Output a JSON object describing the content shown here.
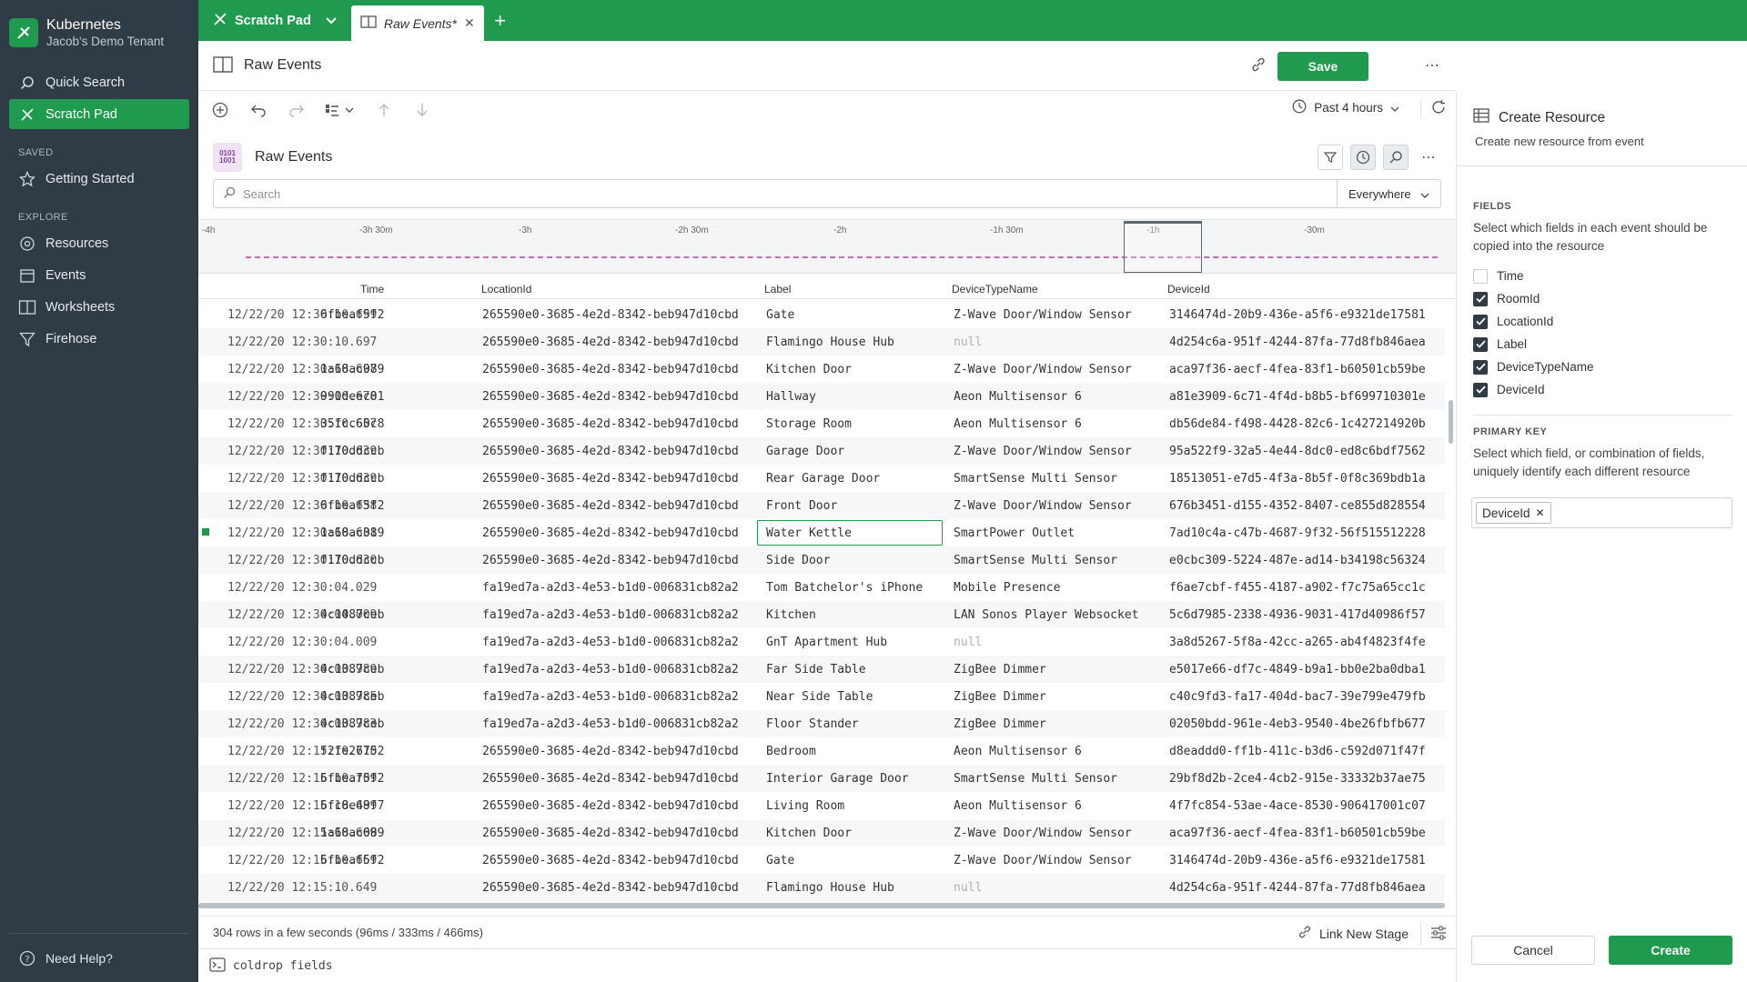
{
  "colors": {
    "brand_green": "#1f9a4f",
    "sidebar_bg": "#2f3b45",
    "selected_outline": "#1f9a4f",
    "timeline_line": "#b04fa0"
  },
  "sidebar": {
    "app_title": "Kubernetes",
    "tenant": "Jacob's Demo Tenant",
    "nav": [
      {
        "label": "Quick Search",
        "icon": "search-icon"
      },
      {
        "label": "Scratch Pad",
        "icon": "scratch-pad-icon",
        "active": true
      }
    ],
    "saved_label": "SAVED",
    "saved": [
      {
        "label": "Getting Started",
        "icon": "star-icon"
      }
    ],
    "explore_label": "EXPLORE",
    "explore": [
      {
        "label": "Resources",
        "icon": "resources-icon"
      },
      {
        "label": "Events",
        "icon": "calendar-icon"
      },
      {
        "label": "Worksheets",
        "icon": "worksheet-icon"
      },
      {
        "label": "Firehose",
        "icon": "funnel-icon"
      }
    ],
    "help_label": "Need Help?"
  },
  "topbar": {
    "scratch_tab": "Scratch Pad",
    "worksheet_tab": "Raw Events*"
  },
  "header": {
    "title": "Raw Events",
    "save_label": "Save"
  },
  "toolbar": {
    "time_range": "Past 4 hours"
  },
  "stage": {
    "icon_text": "0101 1001",
    "title": "Raw Events",
    "search_placeholder": "Search",
    "scope": "Everywhere"
  },
  "timeline": {
    "labels": [
      "-4h",
      "-3h 30m",
      "-3h",
      "-2h 30m",
      "-2h",
      "-1h 30m",
      "-1h",
      "-30m"
    ]
  },
  "table": {
    "columns": [
      "Time",
      "LocationId",
      "Label",
      "DeviceTypeName",
      "DeviceId"
    ],
    "rows": [
      {
        "time": "12/22/20 12:30:10.699",
        "room": "6fbeaf5f2",
        "location": "265590e0-3685-4e2d-8342-beb947d10cbd",
        "label": "Gate",
        "type": "Z-Wave Door/Window Sensor",
        "device": "3146474d-20b9-436e-a5f6-e9321de17581"
      },
      {
        "time": "12/22/20 12:30:10.697",
        "room": "",
        "location": "265590e0-3685-4e2d-8342-beb947d10cbd",
        "label": "Flamingo House Hub",
        "type": "null",
        "device": "4d254c6a-951f-4244-87fa-77d8fb846aea"
      },
      {
        "time": "12/22/20 12:30:10.697",
        "room": "1a68ac089",
        "location": "265590e0-3685-4e2d-8342-beb947d10cbd",
        "label": "Kitchen Door",
        "type": "Z-Wave Door/Window Sensor",
        "device": "aca97f36-aecf-4fea-83f1-b60501cb59be"
      },
      {
        "time": "12/22/20 12:30:10.678",
        "room": "990deec01",
        "location": "265590e0-3685-4e2d-8342-beb947d10cbd",
        "label": "Hallway",
        "type": "Aeon Multisensor 6",
        "device": "a81e3909-6c71-4f4d-b8b5-bf699710301e"
      },
      {
        "time": "12/22/20 12:30:10.657",
        "room": "35fcc60c8",
        "location": "265590e0-3685-4e2d-8342-beb947d10cbd",
        "label": "Storage Room",
        "type": "Aeon Multisensor 6",
        "device": "db56de84-f498-4428-82c6-1c427214920b"
      },
      {
        "time": "12/22/20 12:30:10.639",
        "room": "f170ddccb",
        "location": "265590e0-3685-4e2d-8342-beb947d10cbd",
        "label": "Garage Door",
        "type": "Z-Wave Door/Window Sensor",
        "device": "95a522f9-32a5-4e44-8dc0-ed8c6bdf7562"
      },
      {
        "time": "12/22/20 12:30:10.639",
        "room": "f170ddccb",
        "location": "265590e0-3685-4e2d-8342-beb947d10cbd",
        "label": "Rear Garage Door",
        "type": "SmartSense Multi Sensor",
        "device": "18513051-e7d5-4f3a-8b5f-0f8c369bdb1a"
      },
      {
        "time": "12/22/20 12:30:10.638",
        "room": "6fbeaf5f2",
        "location": "265590e0-3685-4e2d-8342-beb947d10cbd",
        "label": "Front Door",
        "type": "Z-Wave Door/Window Sensor",
        "device": "676b3451-d155-4352-8407-ce855d828554"
      },
      {
        "time": "12/22/20 12:30:10.631",
        "room": "1a68ac089",
        "location": "265590e0-3685-4e2d-8342-beb947d10cbd",
        "label": "Water Kettle",
        "type": "SmartPower Outlet",
        "device": "7ad10c4a-c47b-4687-9f32-56f515512228",
        "selected": true
      },
      {
        "time": "12/22/20 12:30:10.630",
        "room": "f170ddccb",
        "location": "265590e0-3685-4e2d-8342-beb947d10cbd",
        "label": "Side Door",
        "type": "SmartSense Multi Sensor",
        "device": "e0cbc309-5224-487e-ad14-b34198c56324"
      },
      {
        "time": "12/22/20 12:30:04.029",
        "room": "",
        "location": "fa19ed7a-a2d3-4e53-b1d0-006831cb82a2",
        "label": "Tom Batchelor's iPhone",
        "type": "Mobile Presence",
        "device": "f6ae7cbf-f455-4187-a902-f7c75a65cc1c"
      },
      {
        "time": "12/22/20 12:30:04.009",
        "room": "4c1087ceb",
        "location": "fa19ed7a-a2d3-4e53-b1d0-006831cb82a2",
        "label": "Kitchen",
        "type": "LAN Sonos Player Websocket",
        "device": "5c6d7985-2338-4936-9031-417d40986f57"
      },
      {
        "time": "12/22/20 12:30:04.009",
        "room": "",
        "location": "fa19ed7a-a2d3-4e53-b1d0-006831cb82a2",
        "label": "GnT Apartment Hub",
        "type": "null",
        "device": "3a8d5267-5f8a-42cc-a265-ab4f4823f4fe"
      },
      {
        "time": "12/22/20 12:30:03.989",
        "room": "4c1087ceb",
        "location": "fa19ed7a-a2d3-4e53-b1d0-006831cb82a2",
        "label": "Far Side Table",
        "type": "ZigBee Dimmer",
        "device": "e5017e66-df7c-4849-b9a1-bb0e2ba0dba1"
      },
      {
        "time": "12/22/20 12:30:03.985",
        "room": "4c1087ceb",
        "location": "fa19ed7a-a2d3-4e53-b1d0-006831cb82a2",
        "label": "Near Side Table",
        "type": "ZigBee Dimmer",
        "device": "c40c9fd3-fa17-404d-bac7-39e799e479fb"
      },
      {
        "time": "12/22/20 12:30:03.983",
        "room": "4c1087ceb",
        "location": "fa19ed7a-a2d3-4e53-b1d0-006831cb82a2",
        "label": "Floor Stander",
        "type": "ZigBee Dimmer",
        "device": "02050bdd-961e-4eb3-9540-4be26fbfb677"
      },
      {
        "time": "12/22/20 12:15:10.710",
        "room": "f2fe26752",
        "location": "265590e0-3685-4e2d-8342-beb947d10cbd",
        "label": "Bedroom",
        "type": "Aeon Multisensor 6",
        "device": "d8eaddd0-ff1b-411c-b3d6-c592d071f47f"
      },
      {
        "time": "12/22/20 12:15:10.709",
        "room": "6fbeaf5f2",
        "location": "265590e0-3685-4e2d-8342-beb947d10cbd",
        "label": "Interior Garage Door",
        "type": "SmartSense Multi Sensor",
        "device": "29bf8d2b-2ce4-4cb2-915e-33332b37ae75"
      },
      {
        "time": "12/22/20 12:15:10.689",
        "room": "6fc8e49f7",
        "location": "265590e0-3685-4e2d-8342-beb947d10cbd",
        "label": "Living Room",
        "type": "Aeon Multisensor 6",
        "device": "4f7fc854-53ae-4ace-8530-906417001c07"
      },
      {
        "time": "12/22/20 12:15:10.669",
        "room": "1a68ac089",
        "location": "265590e0-3685-4e2d-8342-beb947d10cbd",
        "label": "Kitchen Door",
        "type": "Z-Wave Door/Window Sensor",
        "device": "aca97f36-aecf-4fea-83f1-b60501cb59be"
      },
      {
        "time": "12/22/20 12:15:10.669",
        "room": "6fbeaf5f2",
        "location": "265590e0-3685-4e2d-8342-beb947d10cbd",
        "label": "Gate",
        "type": "Z-Wave Door/Window Sensor",
        "device": "3146474d-20b9-436e-a5f6-e9321de17581"
      },
      {
        "time": "12/22/20 12:15:10.649",
        "room": "",
        "location": "265590e0-3685-4e2d-8342-beb947d10cbd",
        "label": "Flamingo House Hub",
        "type": "null",
        "device": "4d254c6a-951f-4244-87fa-77d8fb846aea"
      }
    ]
  },
  "status": {
    "summary": "304 rows in a few seconds (96ms / 333ms / 466ms)",
    "link_label": "Link New Stage",
    "console_text": "coldrop fields"
  },
  "panel": {
    "title": "Create Resource",
    "subtitle": "Create new resource from event",
    "fields_label": "FIELDS",
    "fields_desc": "Select which fields in each event should be copied into the resource",
    "fields": [
      {
        "label": "Time",
        "checked": false
      },
      {
        "label": "RoomId",
        "checked": true
      },
      {
        "label": "LocationId",
        "checked": true
      },
      {
        "label": "Label",
        "checked": true
      },
      {
        "label": "DeviceTypeName",
        "checked": true
      },
      {
        "label": "DeviceId",
        "checked": true
      }
    ],
    "pk_label": "PRIMARY KEY",
    "pk_desc": "Select which field, or combination of fields, uniquely identify each different resource",
    "pk_chip": "DeviceId",
    "cancel_label": "Cancel",
    "create_label": "Create"
  }
}
